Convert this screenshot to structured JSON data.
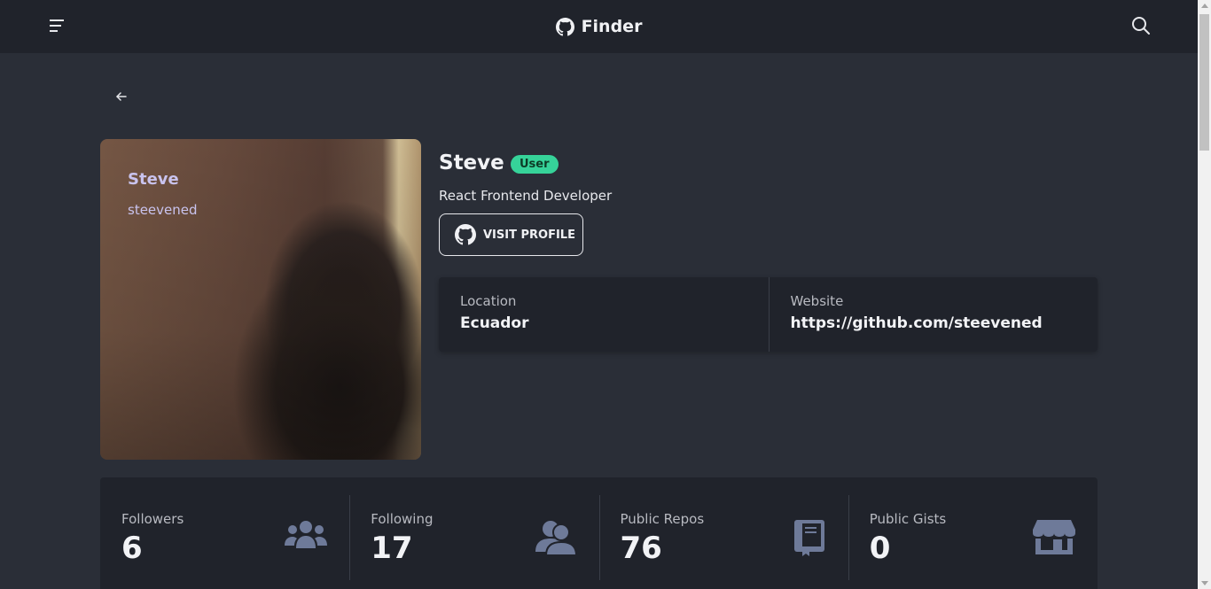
{
  "navbar": {
    "brand": "Finder",
    "menu_icon": "hamburger-icon",
    "search_icon": "search-icon",
    "brand_icon": "github-icon"
  },
  "profile": {
    "photo_name": "Steve",
    "photo_login": "steevened",
    "name": "Steve",
    "badge": "User",
    "bio": "React Frontend Developer",
    "visit_button": "VISIT PROFILE"
  },
  "info": {
    "location_label": "Location",
    "location_value": "Ecuador",
    "website_label": "Website",
    "website_value": "https://github.com/steevened"
  },
  "stats": [
    {
      "label": "Followers",
      "value": "6",
      "icon": "users-icon"
    },
    {
      "label": "Following",
      "value": "17",
      "icon": "user-friends-icon"
    },
    {
      "label": "Public Repos",
      "value": "76",
      "icon": "book-icon"
    },
    {
      "label": "Public Gists",
      "value": "0",
      "icon": "store-icon"
    }
  ],
  "colors": {
    "background": "#2a2e37",
    "panel": "#20232b",
    "badge": "#36d399"
  }
}
